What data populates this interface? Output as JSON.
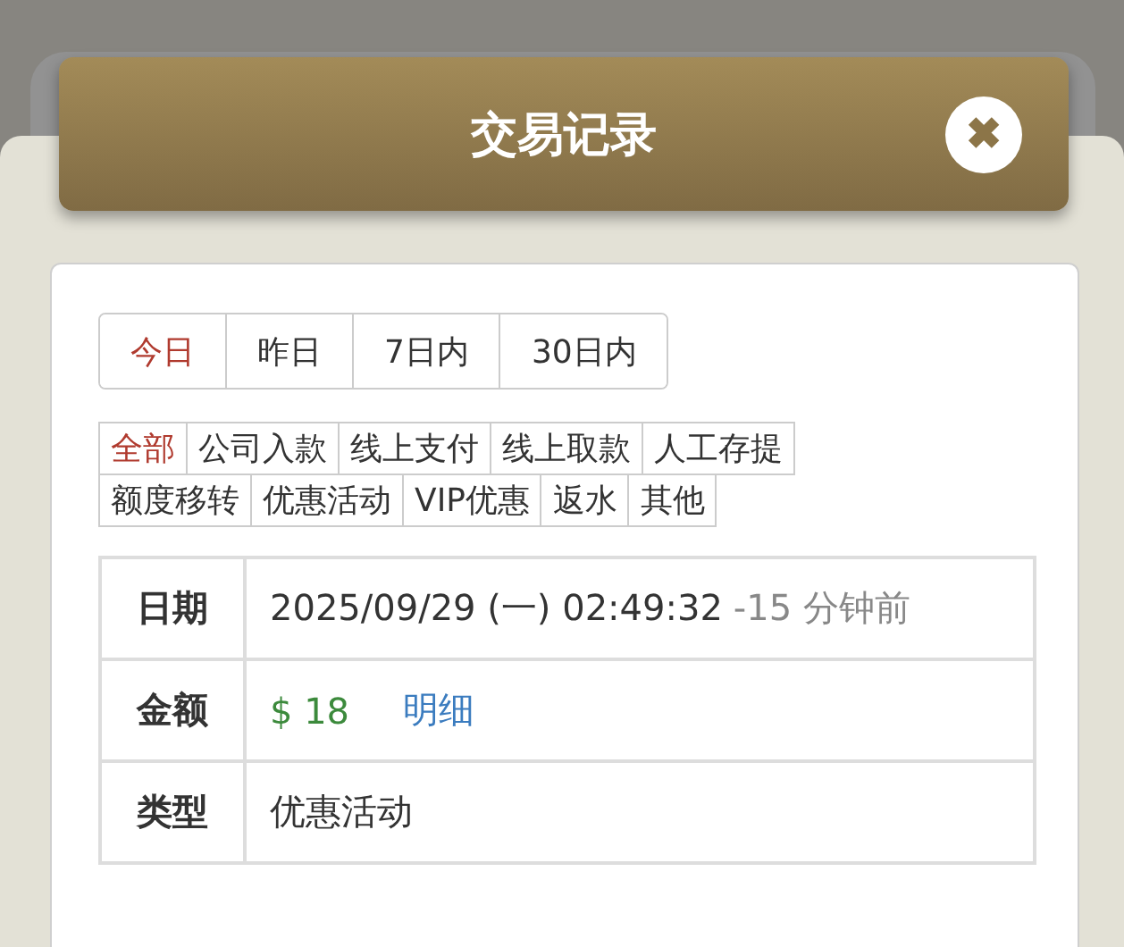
{
  "dialog": {
    "title": "交易记录",
    "close_icon": "✖"
  },
  "period_tabs": [
    {
      "label": "今日",
      "selected": true
    },
    {
      "label": "昨日",
      "selected": false
    },
    {
      "label": "7日内",
      "selected": false
    },
    {
      "label": "30日内",
      "selected": false
    }
  ],
  "type_filters": [
    [
      {
        "label": "全部",
        "selected": true
      },
      {
        "label": "公司入款",
        "selected": false
      },
      {
        "label": "线上支付",
        "selected": false
      },
      {
        "label": "线上取款",
        "selected": false
      },
      {
        "label": "人工存提",
        "selected": false
      }
    ],
    [
      {
        "label": "额度移转",
        "selected": false
      },
      {
        "label": "优惠活动",
        "selected": false
      },
      {
        "label": "VIP优惠",
        "selected": false
      },
      {
        "label": "返水",
        "selected": false
      },
      {
        "label": "其他",
        "selected": false
      }
    ]
  ],
  "record": [
    {
      "kind": "date",
      "label": "日期",
      "value": "2025/09/29 (一) 02:49:32",
      "note": "-15 分钟前"
    },
    {
      "kind": "amount",
      "label": "金额",
      "value": "$ 18",
      "link": "明细"
    },
    {
      "kind": "text",
      "label": "类型",
      "value": "优惠活动"
    }
  ]
}
